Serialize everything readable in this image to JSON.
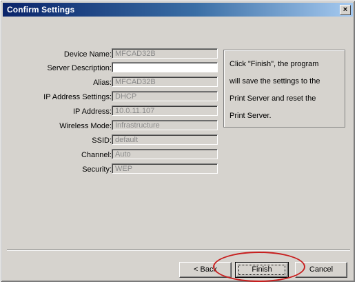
{
  "window": {
    "title": "Confirm Settings",
    "close_label": "×"
  },
  "fields": [
    {
      "label": "Device Name:",
      "value": "MFCAD32B"
    },
    {
      "label": "Server Description:",
      "value": ""
    },
    {
      "label": "Alias:",
      "value": "MFCAD32B"
    },
    {
      "label": "IP Address Settings:",
      "value": "DHCP"
    },
    {
      "label": "IP Address:",
      "value": "10.0.11.107"
    },
    {
      "label": "Wireless Mode:",
      "value": "Infrastructure"
    },
    {
      "label": "SSID:",
      "value": "default"
    },
    {
      "label": "Channel:",
      "value": "Auto"
    },
    {
      "label": "Security:",
      "value": "WEP"
    }
  ],
  "info": {
    "lines": [
      "Click \"Finish\", the program",
      "will save the settings to the",
      "Print Server and reset the",
      "Print Server."
    ]
  },
  "buttons": {
    "back": "< Back",
    "finish": "Finish",
    "cancel": "Cancel"
  },
  "colors": {
    "annotation": "#c81e1e",
    "titlebar_start": "#0a246a"
  }
}
